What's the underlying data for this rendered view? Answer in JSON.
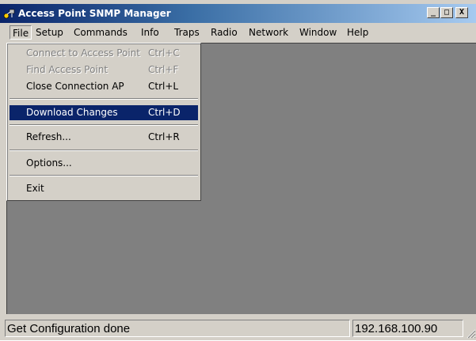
{
  "window": {
    "title": "Access Point SNMP Manager",
    "buttons": {
      "minimize": "_",
      "maximize": "□",
      "close": "X"
    }
  },
  "menubar": {
    "items": [
      "File",
      "Setup",
      "Commands",
      "Info",
      "Traps",
      "Radio",
      "Network",
      "Window",
      "Help"
    ]
  },
  "file_menu": {
    "items": [
      {
        "label": "Connect to Access Point",
        "shortcut": "Ctrl+C",
        "state": "disabled"
      },
      {
        "label": "Find Access Point",
        "shortcut": "Ctrl+F",
        "state": "disabled"
      },
      {
        "label": "Close Connection AP",
        "shortcut": "Ctrl+L",
        "state": "enabled"
      },
      {
        "label": "Download Changes",
        "shortcut": "Ctrl+D",
        "state": "selected"
      },
      {
        "label": "Refresh...",
        "shortcut": "Ctrl+R",
        "state": "enabled"
      },
      {
        "label": "Options...",
        "shortcut": "",
        "state": "enabled"
      },
      {
        "label": "Exit",
        "shortcut": "",
        "state": "enabled"
      }
    ]
  },
  "statusbar": {
    "message": "Get Configuration done",
    "ip": "192.168.100.90"
  },
  "colors": {
    "title_active": "#0a246a",
    "selection": "#0a246a",
    "client_bg": "#808080",
    "face": "#d4d0c8"
  },
  "icons": {
    "app": "app-network-icon",
    "grip": "resize-grip-icon"
  }
}
